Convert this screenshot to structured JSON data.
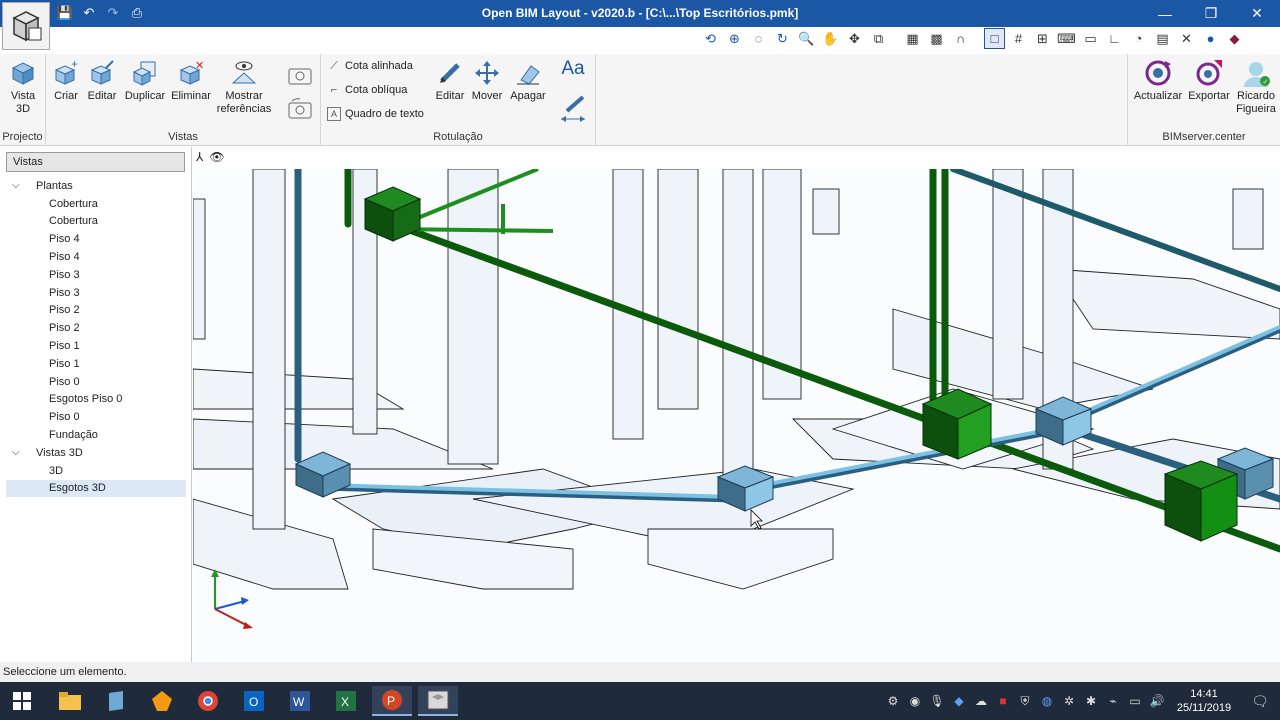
{
  "title_bar": {
    "title": "Open BIM Layout - v2020.b - [C:\\...\\Top Escritórios.pmk]",
    "quick_access": [
      "save-icon",
      "undo-icon",
      "redo-icon",
      "print-icon"
    ],
    "window_buttons": [
      "minimize",
      "restore",
      "close"
    ]
  },
  "ribbon": {
    "groups": {
      "projecto": {
        "label": "Projecto",
        "buttons": [
          {
            "label": "Vista\n3D",
            "icon": "cube-icon"
          }
        ]
      },
      "vistas": {
        "label": "Vistas",
        "buttons": [
          {
            "label": "Criar",
            "icon": "cube-add-icon"
          },
          {
            "label": "Editar",
            "icon": "cube-edit-icon"
          },
          {
            "label": "Duplicar",
            "icon": "cube-duplicate-icon"
          },
          {
            "label": "Eliminar",
            "icon": "cube-delete-icon"
          },
          {
            "label": "Mostrar\nreferências",
            "icon": "eye-icon"
          }
        ]
      },
      "rotulacao": {
        "label": "Rotulação",
        "small_items": [
          "Cota alinhada",
          "Cota oblíqua",
          "Quadro de texto"
        ],
        "buttons": [
          {
            "label": "Editar",
            "icon": "pencil-icon"
          },
          {
            "label": "Mover",
            "icon": "move-icon"
          },
          {
            "label": "Apagar",
            "icon": "eraser-icon"
          }
        ],
        "font_label": "Aa"
      },
      "bimserver": {
        "label": "BIMserver.center",
        "buttons": [
          {
            "label": "Actualizar",
            "icon": "refresh-icon"
          },
          {
            "label": "Exportar",
            "icon": "export-icon"
          },
          {
            "label": "Ricardo\nFigueira",
            "icon": "user-icon"
          }
        ]
      }
    }
  },
  "left_panel": {
    "header": "Vistas",
    "tree": [
      {
        "label": "Plantas",
        "type": "group"
      },
      {
        "label": "Cobertura",
        "type": "leaf"
      },
      {
        "label": "Cobertura",
        "type": "leaf"
      },
      {
        "label": "Piso 4",
        "type": "leaf"
      },
      {
        "label": "Piso 4",
        "type": "leaf"
      },
      {
        "label": "Piso 3",
        "type": "leaf"
      },
      {
        "label": "Piso 3",
        "type": "leaf"
      },
      {
        "label": "Piso 2",
        "type": "leaf"
      },
      {
        "label": "Piso 2",
        "type": "leaf"
      },
      {
        "label": "Piso 1",
        "type": "leaf"
      },
      {
        "label": "Piso 1",
        "type": "leaf"
      },
      {
        "label": "Piso 0",
        "type": "leaf"
      },
      {
        "label": "Esgotos Piso 0",
        "type": "leaf"
      },
      {
        "label": "Piso 0",
        "type": "leaf"
      },
      {
        "label": "Fundação",
        "type": "leaf"
      },
      {
        "label": "Vistas 3D",
        "type": "group"
      },
      {
        "label": "3D",
        "type": "leaf"
      },
      {
        "label": "Esgotos 3D",
        "type": "leaf",
        "selected": true
      }
    ]
  },
  "status_bar": {
    "text": "Seleccione um elemento."
  },
  "taskbar": {
    "apps": [
      "windows-start",
      "file-explorer",
      "app-blue",
      "app-orange",
      "chrome",
      "outlook",
      "word",
      "excel",
      "powerpoint",
      "open-bim-layout"
    ],
    "clock": {
      "time": "14:41",
      "date": "25/11/2019"
    }
  },
  "colors": {
    "title_bar": "#1c57a6",
    "pipe_green": "#0c5a0c",
    "pipe_blue": "#5aa3cc",
    "taskbar": "#1f2a3a"
  }
}
